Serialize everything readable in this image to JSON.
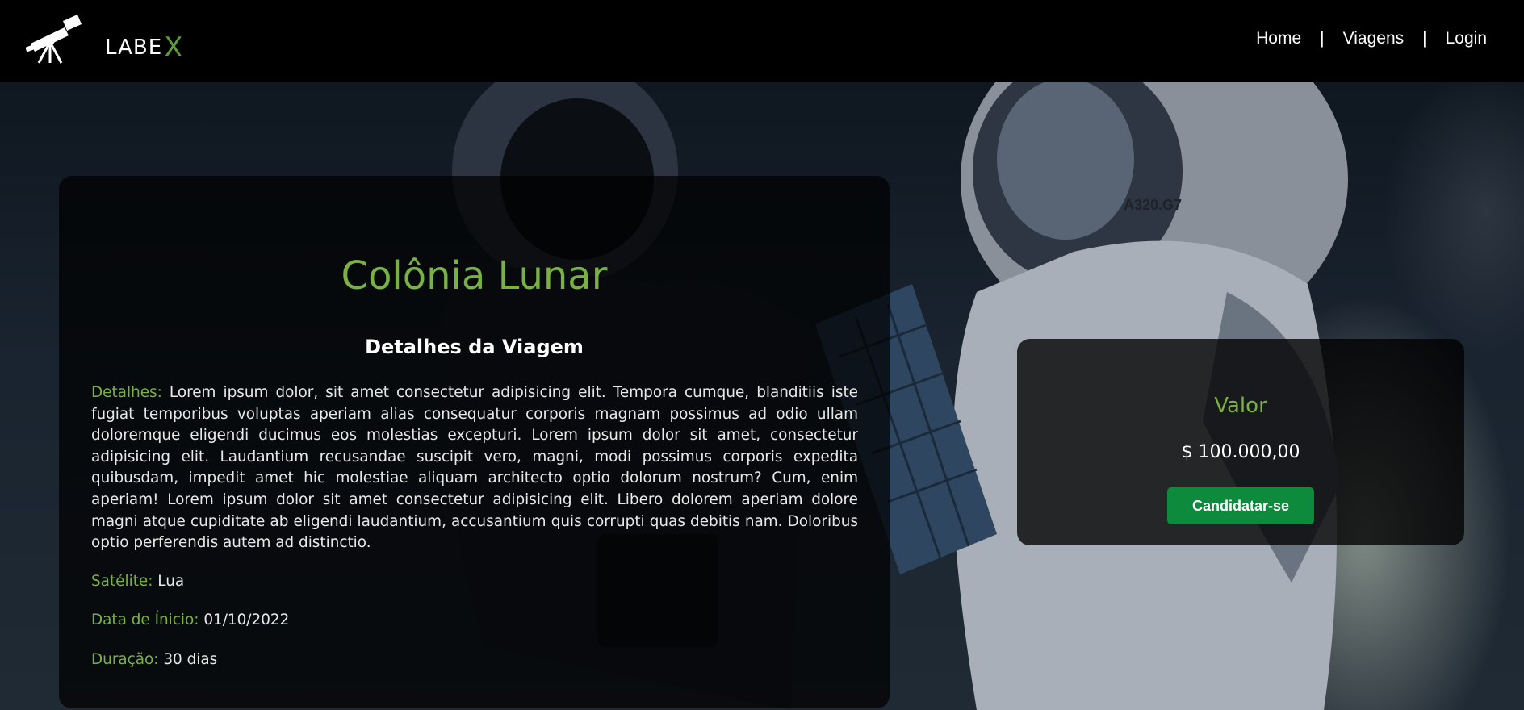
{
  "header": {
    "logo_text": "LABE",
    "logo_mark": "X",
    "nav": [
      "Home",
      "Viagens",
      "Login"
    ],
    "separator": "|"
  },
  "trip": {
    "title": "Colônia Lunar",
    "section_title": "Detalhes da Viagem",
    "details_label": "Detalhes:",
    "details_text": "Lorem ipsum dolor, sit amet consectetur adipisicing elit. Tempora cumque, blanditiis iste fugiat temporibus voluptas aperiam alias consequatur corporis magnam possimus ad odio ullam doloremque eligendi ducimus eos molestias excepturi. Lorem ipsum dolor sit amet, consectetur adipisicing elit. Laudantium recusandae suscipit vero, magni, modi possimus corporis expedita quibusdam, impedit amet hic molestiae aliquam architecto optio dolorum nostrum? Cum, enim aperiam! Lorem ipsum dolor sit amet consectetur adipisicing elit. Libero dolorem aperiam dolore magni atque cupiditate ab eligendi laudantium, accusantium quis corrupti quas debitis nam. Doloribus optio perferendis autem ad distinctio.",
    "satellite_label": "Satélite:",
    "satellite_value": "Lua",
    "start_label": "Data de Ínicio:",
    "start_value": "01/10/2022",
    "duration_label": "Duração:",
    "duration_value": "30 dias"
  },
  "price": {
    "label": "Valor",
    "value": "$ 100.000,00",
    "button": "Candidatar-se"
  },
  "background": {
    "helmet_tag": "A320.G7"
  },
  "colors": {
    "accent_green": "#79b143",
    "button_green": "#0e8a3c",
    "header_bg": "#000000"
  },
  "icons": {
    "logo": "telescope-icon"
  }
}
